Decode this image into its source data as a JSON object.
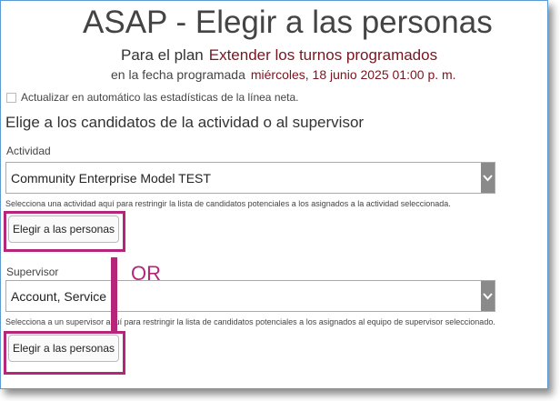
{
  "header": {
    "title": "ASAP - Elegir a las personas",
    "plan_prefix": "Para el plan",
    "plan_name": "Extender los turnos programados",
    "date_prefix": "en la fecha programada",
    "date_value": "miércoles, 18 junio 2025 01:00 p. m."
  },
  "auto_update": {
    "label": "Actualizar en automático las estadísticas de la línea neta.",
    "checked": false
  },
  "section_heading": "Elige a los candidatos de la actividad o al supervisor",
  "activity": {
    "label": "Actividad",
    "selected": "Community Enterprise Model TEST",
    "help": "Selecciona una actividad aquí para restringir la lista de candidatos potenciales a los asignados a la actividad seleccionada.",
    "button": "Elegir a las personas"
  },
  "supervisor": {
    "label": "Supervisor",
    "selected": "Account, Service",
    "help": "Selecciona a un supervisor aquí para restringir la lista de candidatos potenciales a los asignados al equipo de supervisor seleccionado.",
    "button": "Elegir a las personas"
  },
  "annotation": {
    "or_label": "OR",
    "highlight_color": "#b5267b"
  },
  "icons": {
    "dropdown": "chevron-down-icon"
  }
}
